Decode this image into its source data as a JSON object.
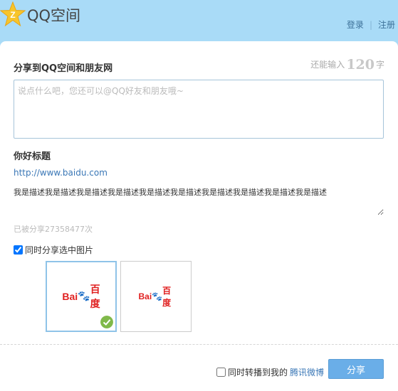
{
  "header": {
    "logo_text": "QQ空间",
    "login_label": "登录",
    "separator": "|",
    "register_label": "注册"
  },
  "share": {
    "title": "分享到QQ空间和朋友网",
    "counter_prefix": "还能输入",
    "counter_value": "120",
    "counter_suffix": "字",
    "comment_placeholder": "说点什么吧，您还可以@QQ好友和朋友哦~",
    "comment_value": ""
  },
  "post": {
    "title": "你好标题",
    "url": "http://www.baidu.com",
    "description": "我是描述我是描述我是描述我是描述我是描述我是描述我是描述我是描述我是描述我是描述",
    "shared_count": "已被分享27358477次"
  },
  "images": {
    "checkbox_label": "同时分享选中图片",
    "checked": true,
    "thumbnails": [
      {
        "logo_bai": "Bai",
        "logo_du": "百度",
        "selected": true
      },
      {
        "logo_bai": "Bai",
        "logo_du": "百度",
        "selected": false
      }
    ]
  },
  "footer": {
    "weibo_prefix": "同时转播到我的",
    "weibo_link": "腾讯微博",
    "weibo_checked": false,
    "share_button": "分享"
  },
  "colors": {
    "header_bg": "#a9dbf7",
    "link": "#3a77b6",
    "button_bg": "#6aaee8",
    "check_badge": "#80b94a"
  }
}
